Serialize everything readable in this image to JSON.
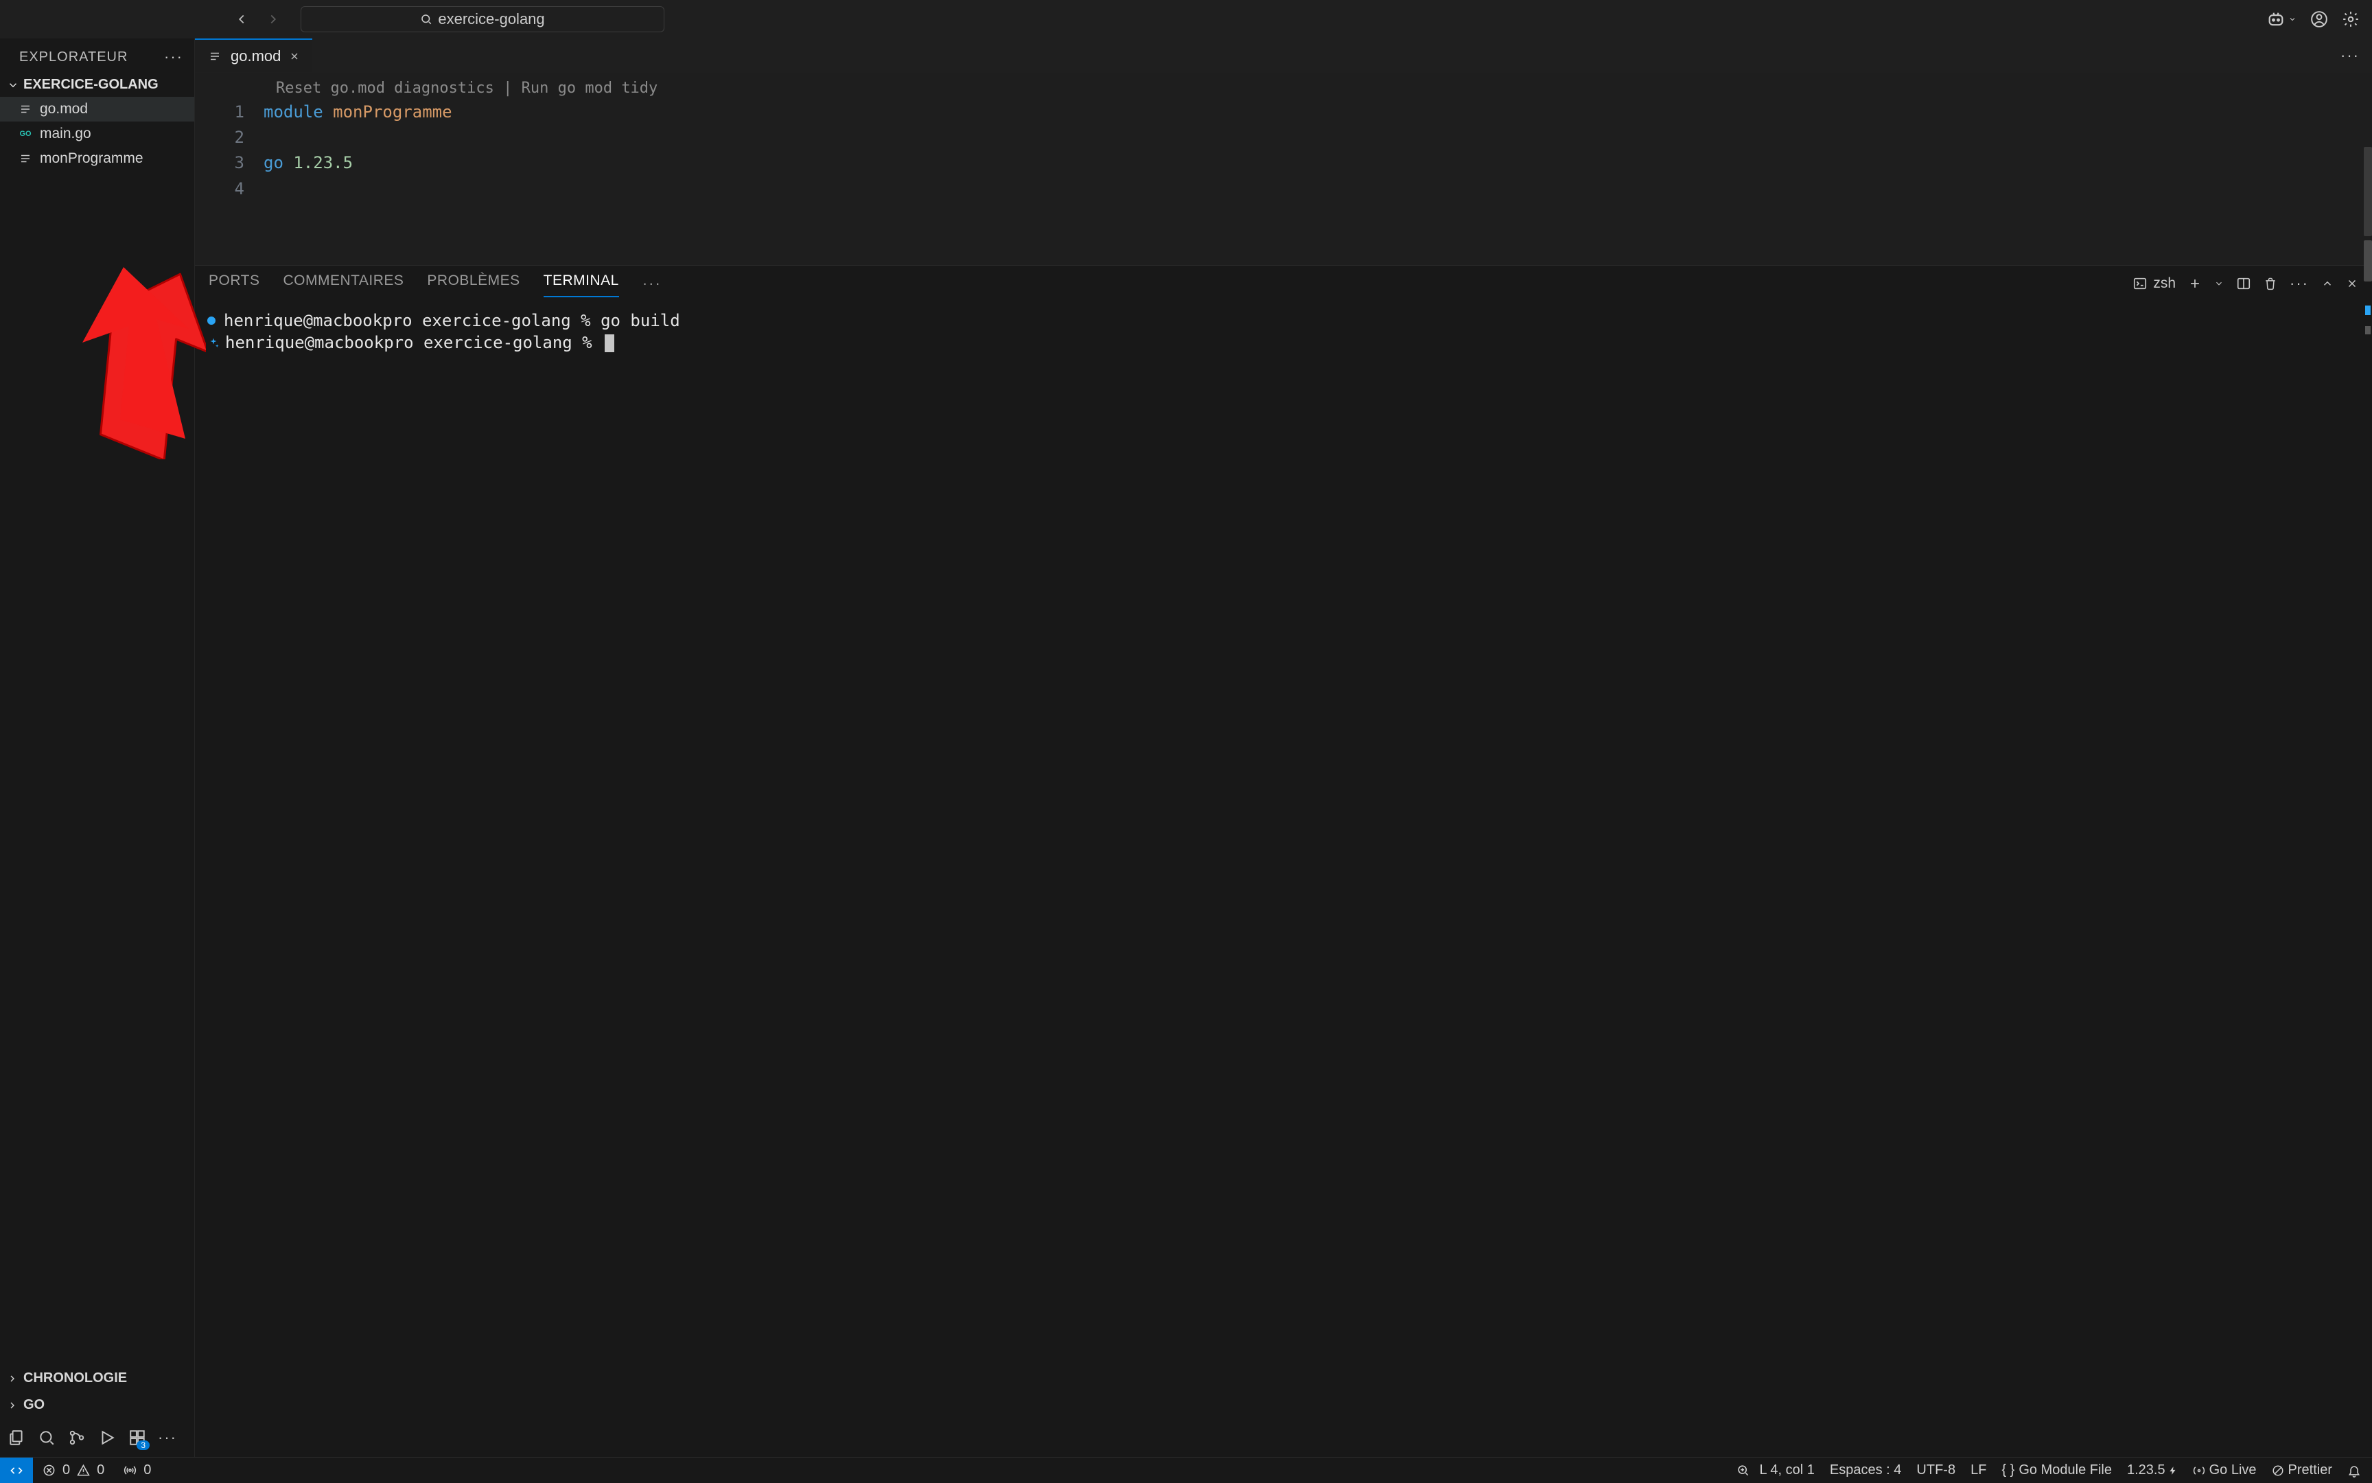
{
  "titlebar": {
    "search_text": "exercice-golang"
  },
  "sidebar": {
    "title": "EXPLORATEUR",
    "folder": "EXERCICE-GOLANG",
    "files": [
      {
        "name": "go.mod",
        "icon": "lines",
        "active": true
      },
      {
        "name": "main.go",
        "icon": "go",
        "active": false
      },
      {
        "name": "monProgramme",
        "icon": "lines",
        "active": false
      }
    ],
    "sections": [
      {
        "label": "CHRONOLOGIE"
      },
      {
        "label": "GO"
      }
    ],
    "ext_badge": "3"
  },
  "tabs": {
    "open": [
      {
        "label": "go.mod"
      }
    ]
  },
  "editor": {
    "codelens": "Reset go.mod diagnostics | Run go mod tidy",
    "lines": [
      {
        "n": "1",
        "tokens": [
          {
            "t": "module",
            "c": "tok-kw"
          },
          {
            "t": " ",
            "c": ""
          },
          {
            "t": "monProgramme",
            "c": "tok-id"
          }
        ]
      },
      {
        "n": "2",
        "tokens": []
      },
      {
        "n": "3",
        "tokens": [
          {
            "t": "go",
            "c": "tok-kw"
          },
          {
            "t": " ",
            "c": ""
          },
          {
            "t": "1.23.5",
            "c": "tok-num"
          }
        ]
      },
      {
        "n": "4",
        "tokens": []
      }
    ]
  },
  "panel": {
    "tabs": [
      {
        "label": "PORTS",
        "active": false
      },
      {
        "label": "COMMENTAIRES",
        "active": false
      },
      {
        "label": "PROBLÈMES",
        "active": false
      },
      {
        "label": "TERMINAL",
        "active": true
      }
    ],
    "shell": "zsh",
    "terminal": {
      "line1_prompt": "henrique@macbookpro exercice-golang % ",
      "line1_cmd": "go build",
      "line2_prompt": "henrique@macbookpro exercice-golang % "
    }
  },
  "statusbar": {
    "errors": "0",
    "warnings": "0",
    "ports": "0",
    "cursor": "L 4, col 1",
    "spaces": "Espaces : 4",
    "encoding": "UTF-8",
    "eol": "LF",
    "lang": "Go Module File",
    "gover": "1.23.5",
    "golive": "Go Live",
    "prettier": "Prettier"
  }
}
